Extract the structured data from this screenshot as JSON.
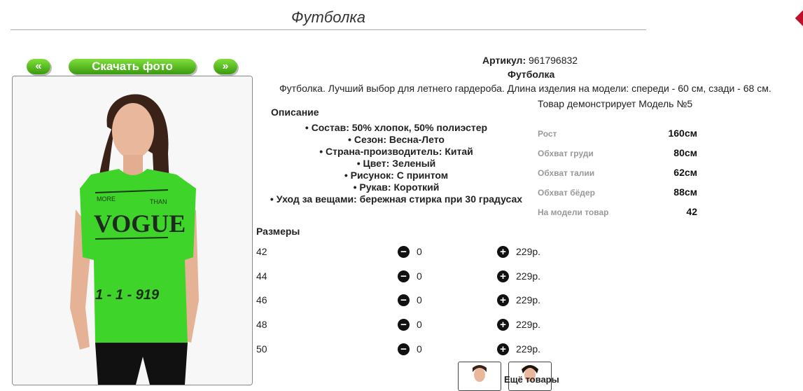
{
  "header": {
    "title": "Футболка"
  },
  "gallery": {
    "prev_label": "«",
    "download_label": "Скачать фото",
    "next_label": "»",
    "shirt_print_top_left": "MORE",
    "shirt_print_top_right": "THAN",
    "shirt_print_main": "VOGUE",
    "shirt_print_bottom": "1 - 1 - 919",
    "shirt_color": "#3fd42a"
  },
  "product": {
    "article_label": "Артикул:",
    "article_value": "961796832",
    "name": "Футболка",
    "summary": "Футболка. Лучший выбор для летнего гардероба. Длина изделия на модели: спереди - 60 см, сзади - 68 см.",
    "description_heading": "Описание",
    "features": [
      "Состав: 50% хлопок, 50% полиэстер",
      "Сезон: Весна-Лето",
      "Страна-производитель: Китай",
      "Цвет: Зеленый",
      "Рисунок: С принтом",
      "Рукав: Короткий",
      "Уход за вещами: бережная стирка при 30 градусах"
    ]
  },
  "model": {
    "title": "Товар демонстрирует Модель №5",
    "params": [
      {
        "label": "Рост",
        "value": "160см"
      },
      {
        "label": "Обхват груди",
        "value": "80см"
      },
      {
        "label": "Обхват талии",
        "value": "62см"
      },
      {
        "label": "Обхват бёдер",
        "value": "88см"
      },
      {
        "label": "На модели товар",
        "value": "42"
      }
    ]
  },
  "sizes": {
    "heading": "Размеры",
    "rows": [
      {
        "size": "42",
        "qty": "0",
        "price": "229р."
      },
      {
        "size": "44",
        "qty": "0",
        "price": "229р."
      },
      {
        "size": "46",
        "qty": "0",
        "price": "229р."
      },
      {
        "size": "48",
        "qty": "0",
        "price": "229р."
      },
      {
        "size": "50",
        "qty": "0",
        "price": "229р."
      }
    ],
    "minus_glyph": "−",
    "plus_glyph": "+"
  },
  "related": {
    "heading": "Ещё товары"
  }
}
